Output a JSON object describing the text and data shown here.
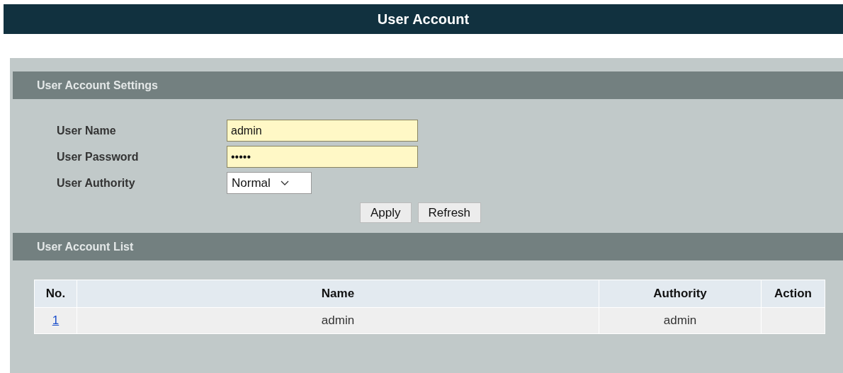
{
  "page_title": "User Account",
  "settings": {
    "title": "User Account Settings",
    "fields": [
      {
        "kind": "text",
        "label": "User Name",
        "value": "admin"
      },
      {
        "kind": "password",
        "label": "User Password",
        "value": "•••••"
      },
      {
        "kind": "select",
        "label": "User Authority",
        "value": "Normal"
      }
    ],
    "buttons": [
      "Apply",
      "Refresh"
    ]
  },
  "list": {
    "title": "User Account List",
    "columns": [
      "No.",
      "Name",
      "Authority",
      "Action"
    ],
    "rows": [
      {
        "no": "1",
        "name": "admin",
        "authority": "admin"
      }
    ]
  }
}
